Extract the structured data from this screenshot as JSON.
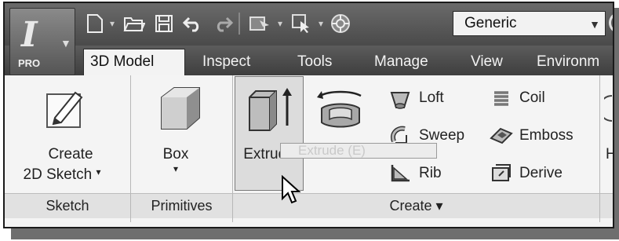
{
  "app": {
    "badge": "PRO",
    "logo_letter": "I"
  },
  "quick_access": {
    "material_dropdown": "Generic"
  },
  "tabs": [
    "3D Model",
    "Inspect",
    "Tools",
    "Manage",
    "View",
    "Environm"
  ],
  "ribbon": {
    "create_2d_sketch": [
      "Create",
      "2D Sketch"
    ],
    "box": "Box",
    "extrude": "Extrude",
    "revolve": "Revolve",
    "loft": "Loft",
    "sweep": "Sweep",
    "rib": "Rib",
    "coil": "Coil",
    "emboss": "Emboss",
    "derive": "Derive",
    "groups": {
      "sketch": "Sketch",
      "primitives": "Primitives",
      "create": "Create ▾"
    }
  },
  "tooltip": "Extrude (E)"
}
